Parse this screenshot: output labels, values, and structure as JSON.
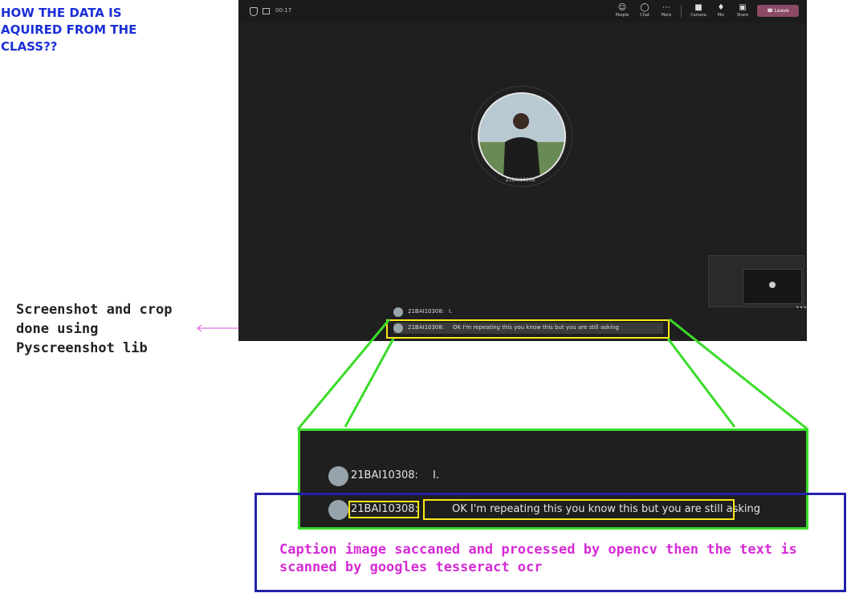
{
  "title": "HOW THE DATA IS AQUIRED FROM THE CLASS??",
  "side_note": "Screenshot and crop done using Pyscreenshot lib",
  "caption_note": "Caption image saccaned and processed by opencv then the text is scanned by googles tesseract ocr",
  "colors": {
    "title": "#1a2fd6",
    "arrow": "#d94fd9",
    "highlight_yellow": "#ffe816",
    "zoom_green": "#3bdc2a",
    "ocr_box_blue": "#2222aa",
    "caption_note": "#d42cd4",
    "meeting_bg": "#1f1f1f",
    "leave_button": "#8c4a66"
  },
  "meeting": {
    "timer": "00:17",
    "toolbar": [
      {
        "label": "People",
        "icon": "people-icon"
      },
      {
        "label": "Chat",
        "icon": "chat-icon"
      },
      {
        "label": "More",
        "icon": "more-icon"
      },
      {
        "label": "Camera",
        "icon": "camera-icon"
      },
      {
        "label": "Mic",
        "icon": "mic-icon"
      },
      {
        "label": "Share",
        "icon": "share-icon"
      }
    ],
    "leave_label": "Leave",
    "participant_name": "21BAI10308",
    "captions": [
      {
        "speaker": "21BAI10308:",
        "text": "I."
      },
      {
        "speaker": "21BAI10308:",
        "text": "OK I'm repeating this you know this but you are still asking"
      }
    ]
  }
}
